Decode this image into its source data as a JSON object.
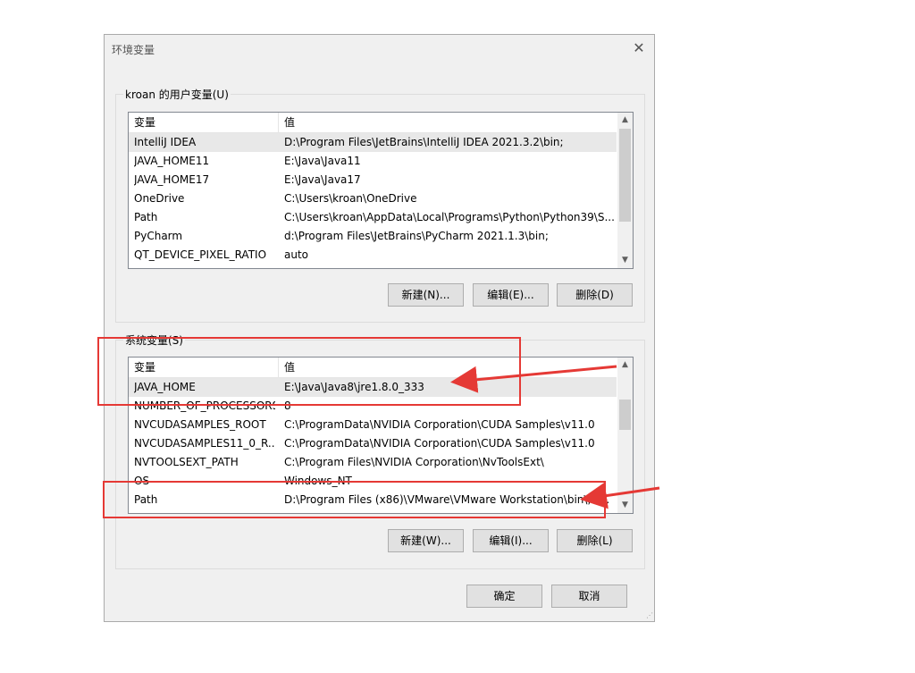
{
  "dialog": {
    "title": "环境变量",
    "close_glyph": "✕"
  },
  "user_vars": {
    "group_label": "kroan 的用户变量(U)",
    "columns": [
      "变量",
      "值"
    ],
    "rows": [
      {
        "name": "IntelliJ IDEA",
        "value": "D:\\Program Files\\JetBrains\\IntelliJ IDEA 2021.3.2\\bin;"
      },
      {
        "name": "JAVA_HOME11",
        "value": "E:\\Java\\Java11"
      },
      {
        "name": "JAVA_HOME17",
        "value": "E:\\Java\\Java17"
      },
      {
        "name": "OneDrive",
        "value": "C:\\Users\\kroan\\OneDrive"
      },
      {
        "name": "Path",
        "value": "C:\\Users\\kroan\\AppData\\Local\\Programs\\Python\\Python39\\S..."
      },
      {
        "name": "PyCharm",
        "value": "d:\\Program Files\\JetBrains\\PyCharm 2021.1.3\\bin;"
      },
      {
        "name": "QT_DEVICE_PIXEL_RATIO",
        "value": "auto"
      }
    ],
    "buttons": {
      "new": "新建(N)...",
      "edit": "编辑(E)...",
      "delete": "删除(D)"
    }
  },
  "system_vars": {
    "group_label": "系统变量(S)",
    "columns": [
      "变量",
      "值"
    ],
    "rows": [
      {
        "name": "JAVA_HOME",
        "value": "E:\\Java\\Java8\\jre1.8.0_333"
      },
      {
        "name": "NUMBER_OF_PROCESSORS",
        "value": "8"
      },
      {
        "name": "NVCUDASAMPLES_ROOT",
        "value": "C:\\ProgramData\\NVIDIA Corporation\\CUDA Samples\\v11.0"
      },
      {
        "name": "NVCUDASAMPLES11_0_R...",
        "value": "C:\\ProgramData\\NVIDIA Corporation\\CUDA Samples\\v11.0"
      },
      {
        "name": "NVTOOLSEXT_PATH",
        "value": "C:\\Program Files\\NVIDIA Corporation\\NvToolsExt\\"
      },
      {
        "name": "OS",
        "value": "Windows_NT"
      },
      {
        "name": "Path",
        "value": "D:\\Program Files (x86)\\VMware\\VMware Workstation\\bin\\;D..."
      }
    ],
    "buttons": {
      "new": "新建(W)...",
      "edit": "编辑(I)...",
      "delete": "删除(L)"
    }
  },
  "footer": {
    "ok": "确定",
    "cancel": "取消"
  },
  "scroll_arrows": {
    "up": "▲",
    "down": "▼"
  },
  "annotation_color": "#e53935"
}
